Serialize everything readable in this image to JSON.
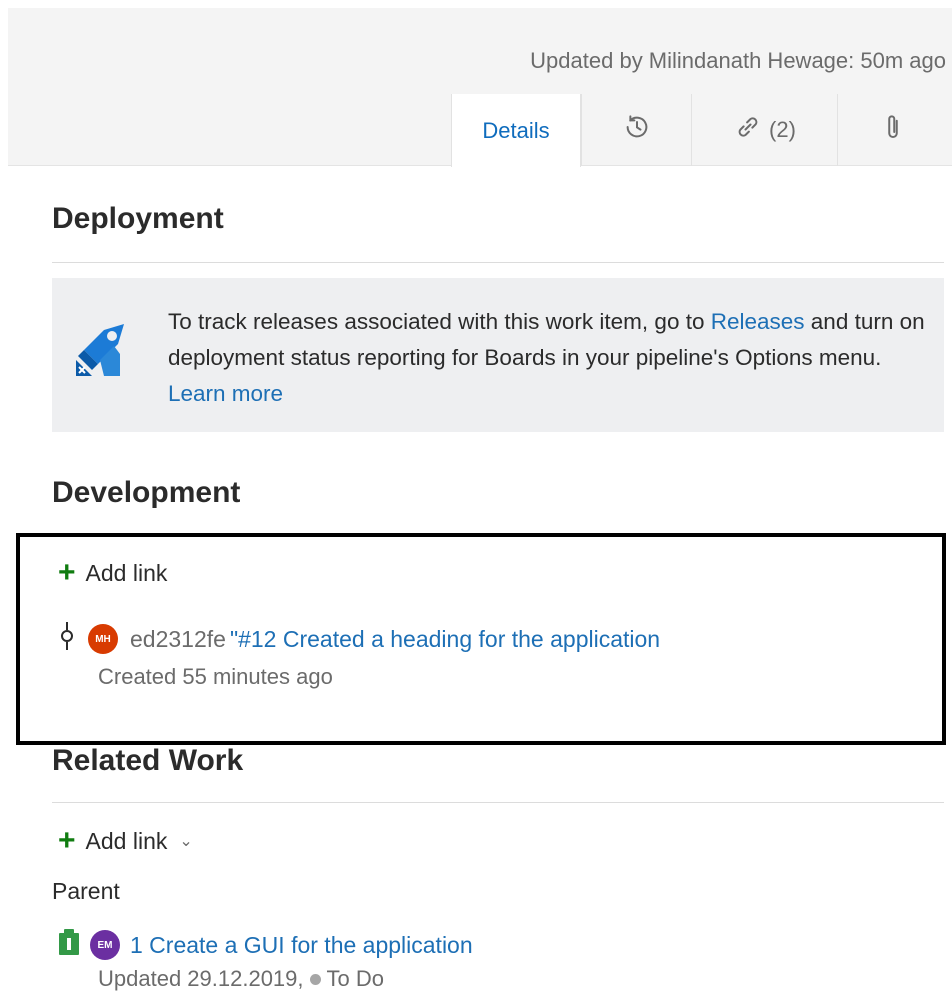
{
  "header": {
    "updated_text": "Updated by Milindanath Hewage: 50m ago",
    "tabs": [
      {
        "label": "Details",
        "active": true
      },
      {
        "icon": "history-icon"
      },
      {
        "icon": "link-icon",
        "label": "(2)"
      },
      {
        "icon": "paperclip-icon"
      }
    ]
  },
  "deployment": {
    "title": "Deployment",
    "icon": "rocket-icon",
    "text_before": "To track releases associated with this work item, go to ",
    "releases_link": "Releases",
    "text_middle": " and turn on deployment status reporting for Boards in your pipeline's Options menu. ",
    "learn_more_link": "Learn more"
  },
  "development": {
    "title": "Development",
    "add_link_label": "Add link",
    "commit": {
      "icon": "commit-icon",
      "avatar_initials": "MH",
      "hash": "ed2312fe",
      "title": "\"#12 Created a heading for the application",
      "created": "Created 55 minutes ago"
    }
  },
  "related_work": {
    "title": "Related Work",
    "add_link_label": "Add link",
    "parent_label": "Parent",
    "parent_item": {
      "icon": "work-item-icon",
      "avatar_initials": "EM",
      "title": "1 Create a GUI for the application",
      "updated": "Updated 29.12.2019,",
      "status": "To Do"
    }
  },
  "colors": {
    "link": "#1d6fb5",
    "add_green": "#107c10",
    "highlight_border": "#000000"
  }
}
